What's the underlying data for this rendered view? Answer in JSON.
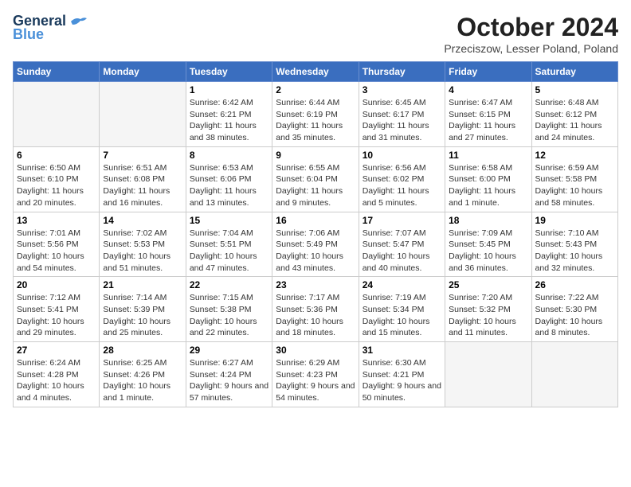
{
  "logo": {
    "line1": "General",
    "line2": "Blue"
  },
  "title": "October 2024",
  "subtitle": "Przeciszow, Lesser Poland, Poland",
  "days_of_week": [
    "Sunday",
    "Monday",
    "Tuesday",
    "Wednesday",
    "Thursday",
    "Friday",
    "Saturday"
  ],
  "weeks": [
    [
      {
        "day": "",
        "empty": true
      },
      {
        "day": "",
        "empty": true
      },
      {
        "day": "1",
        "sunrise": "6:42 AM",
        "sunset": "6:21 PM",
        "daylight": "11 hours and 38 minutes."
      },
      {
        "day": "2",
        "sunrise": "6:44 AM",
        "sunset": "6:19 PM",
        "daylight": "11 hours and 35 minutes."
      },
      {
        "day": "3",
        "sunrise": "6:45 AM",
        "sunset": "6:17 PM",
        "daylight": "11 hours and 31 minutes."
      },
      {
        "day": "4",
        "sunrise": "6:47 AM",
        "sunset": "6:15 PM",
        "daylight": "11 hours and 27 minutes."
      },
      {
        "day": "5",
        "sunrise": "6:48 AM",
        "sunset": "6:12 PM",
        "daylight": "11 hours and 24 minutes."
      }
    ],
    [
      {
        "day": "6",
        "sunrise": "6:50 AM",
        "sunset": "6:10 PM",
        "daylight": "11 hours and 20 minutes."
      },
      {
        "day": "7",
        "sunrise": "6:51 AM",
        "sunset": "6:08 PM",
        "daylight": "11 hours and 16 minutes."
      },
      {
        "day": "8",
        "sunrise": "6:53 AM",
        "sunset": "6:06 PM",
        "daylight": "11 hours and 13 minutes."
      },
      {
        "day": "9",
        "sunrise": "6:55 AM",
        "sunset": "6:04 PM",
        "daylight": "11 hours and 9 minutes."
      },
      {
        "day": "10",
        "sunrise": "6:56 AM",
        "sunset": "6:02 PM",
        "daylight": "11 hours and 5 minutes."
      },
      {
        "day": "11",
        "sunrise": "6:58 AM",
        "sunset": "6:00 PM",
        "daylight": "11 hours and 1 minute."
      },
      {
        "day": "12",
        "sunrise": "6:59 AM",
        "sunset": "5:58 PM",
        "daylight": "10 hours and 58 minutes."
      }
    ],
    [
      {
        "day": "13",
        "sunrise": "7:01 AM",
        "sunset": "5:56 PM",
        "daylight": "10 hours and 54 minutes."
      },
      {
        "day": "14",
        "sunrise": "7:02 AM",
        "sunset": "5:53 PM",
        "daylight": "10 hours and 51 minutes."
      },
      {
        "day": "15",
        "sunrise": "7:04 AM",
        "sunset": "5:51 PM",
        "daylight": "10 hours and 47 minutes."
      },
      {
        "day": "16",
        "sunrise": "7:06 AM",
        "sunset": "5:49 PM",
        "daylight": "10 hours and 43 minutes."
      },
      {
        "day": "17",
        "sunrise": "7:07 AM",
        "sunset": "5:47 PM",
        "daylight": "10 hours and 40 minutes."
      },
      {
        "day": "18",
        "sunrise": "7:09 AM",
        "sunset": "5:45 PM",
        "daylight": "10 hours and 36 minutes."
      },
      {
        "day": "19",
        "sunrise": "7:10 AM",
        "sunset": "5:43 PM",
        "daylight": "10 hours and 32 minutes."
      }
    ],
    [
      {
        "day": "20",
        "sunrise": "7:12 AM",
        "sunset": "5:41 PM",
        "daylight": "10 hours and 29 minutes."
      },
      {
        "day": "21",
        "sunrise": "7:14 AM",
        "sunset": "5:39 PM",
        "daylight": "10 hours and 25 minutes."
      },
      {
        "day": "22",
        "sunrise": "7:15 AM",
        "sunset": "5:38 PM",
        "daylight": "10 hours and 22 minutes."
      },
      {
        "day": "23",
        "sunrise": "7:17 AM",
        "sunset": "5:36 PM",
        "daylight": "10 hours and 18 minutes."
      },
      {
        "day": "24",
        "sunrise": "7:19 AM",
        "sunset": "5:34 PM",
        "daylight": "10 hours and 15 minutes."
      },
      {
        "day": "25",
        "sunrise": "7:20 AM",
        "sunset": "5:32 PM",
        "daylight": "10 hours and 11 minutes."
      },
      {
        "day": "26",
        "sunrise": "7:22 AM",
        "sunset": "5:30 PM",
        "daylight": "10 hours and 8 minutes."
      }
    ],
    [
      {
        "day": "27",
        "sunrise": "6:24 AM",
        "sunset": "4:28 PM",
        "daylight": "10 hours and 4 minutes."
      },
      {
        "day": "28",
        "sunrise": "6:25 AM",
        "sunset": "4:26 PM",
        "daylight": "10 hours and 1 minute."
      },
      {
        "day": "29",
        "sunrise": "6:27 AM",
        "sunset": "4:24 PM",
        "daylight": "9 hours and 57 minutes."
      },
      {
        "day": "30",
        "sunrise": "6:29 AM",
        "sunset": "4:23 PM",
        "daylight": "9 hours and 54 minutes."
      },
      {
        "day": "31",
        "sunrise": "6:30 AM",
        "sunset": "4:21 PM",
        "daylight": "9 hours and 50 minutes."
      },
      {
        "day": "",
        "empty": true
      },
      {
        "day": "",
        "empty": true
      }
    ]
  ],
  "labels": {
    "sunrise": "Sunrise:",
    "sunset": "Sunset:",
    "daylight": "Daylight:"
  }
}
